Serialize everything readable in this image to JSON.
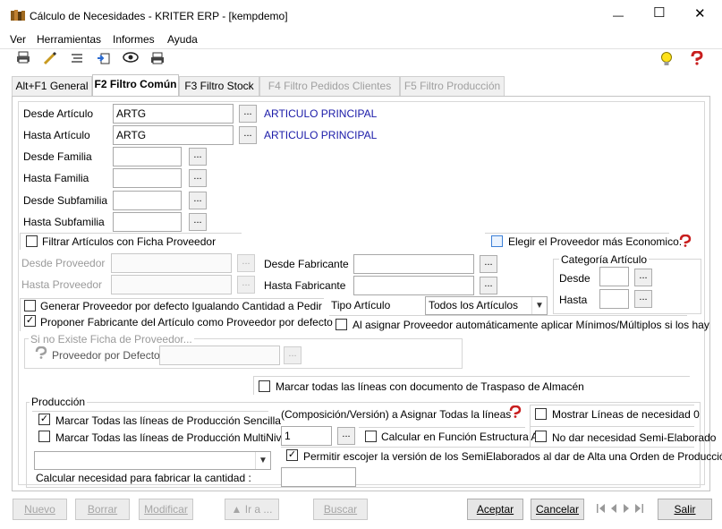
{
  "window": {
    "title": "Cálculo de Necesidades - KRITER ERP - [kempdemo]",
    "minimize": "—",
    "maximize": "☐",
    "close": "✕"
  },
  "menu": [
    "Ver",
    "Herramientas",
    "Informes",
    "Ayuda"
  ],
  "tabs": [
    {
      "label": "Alt+F1 General"
    },
    {
      "label": "F2 Filtro Común"
    },
    {
      "label": "F3 Filtro Stock"
    },
    {
      "label": "F4 Filtro Pedidos Clientes"
    },
    {
      "label": "F5 Filtro Producción"
    }
  ],
  "articles": {
    "desde_articulo": {
      "label": "Desde Artículo",
      "value": "ARTG",
      "desc": "ARTICULO PRINCIPAL"
    },
    "hasta_articulo": {
      "label": "Hasta Artículo",
      "value": "ARTG",
      "desc": "ARTICULO PRINCIPAL"
    },
    "desde_familia": {
      "label": "Desde Familia",
      "value": ""
    },
    "hasta_familia": {
      "label": "Hasta Familia",
      "value": ""
    },
    "desde_subfamilia": {
      "label": "Desde Subfamilia",
      "value": ""
    },
    "hasta_subfamilia": {
      "label": "Hasta Subfamilia",
      "value": ""
    }
  },
  "ellipsis": "...",
  "filtrar_ficha": {
    "label": "Filtrar Artículos con Ficha Proveedor",
    "checked": false
  },
  "elegir_proveedor": {
    "label": "Elegir el Proveedor más Economico.",
    "checked": false
  },
  "proveedor": {
    "desde_label": "Desde Proveedor",
    "hasta_label": "Hasta Proveedor"
  },
  "fabricante": {
    "desde_label": "Desde Fabricante",
    "hasta_label": "Hasta Fabricante"
  },
  "categoria": {
    "title": "Categoría Artículo",
    "desde_label": "Desde",
    "hasta_label": "Hasta"
  },
  "generar_proveedor": {
    "label": "Generar Proveedor por defecto Igualando Cantidad a Pedir",
    "checked": false
  },
  "proponer_fabricante": {
    "label": "Proponer Fabricante del Artículo como Proveedor por defecto",
    "checked": true
  },
  "tipo_articulo": {
    "label": "Tipo Artículo",
    "value": "Todos los Artículos"
  },
  "al_asignar": {
    "label": "Al asignar Proveedor automáticamente aplicar Mínimos/Múltiplos si los hay",
    "checked": false
  },
  "si_no_existe": {
    "title": "Si no Existe Ficha de Proveedor...",
    "proveedor_label": "Proveedor por Defecto"
  },
  "marcar_traspaso": {
    "label": "Marcar todas las líneas con documento de Traspaso de Almacén",
    "checked": false
  },
  "produccion": {
    "title": "Producción",
    "marcar_sencilla": {
      "label": "Marcar Todas las líneas de Producción Sencilla",
      "checked": true
    },
    "marcar_multinivel": {
      "label": "Marcar Todas las líneas de Producción MultiNivel",
      "checked": false
    },
    "composicion_label": "(Composición/Versión) a Asignar Todas la líneas",
    "composicion_value": "1",
    "calcular_estructura": {
      "label": "Calcular en Función Estructura Ar",
      "checked": false
    },
    "mostrar_lineas": {
      "label": "Mostrar Líneas de necesidad 0",
      "checked": false
    },
    "no_dar_necesidad": {
      "label": "No dar necesidad Semi-Elaborado",
      "checked": false
    },
    "permitir_version": {
      "label": "Permitir escojer la versión de los SemiElaborados al dar de Alta una Orden de Producción.",
      "checked": true
    },
    "calcular_cantidad_label": "Calcular necesidad para fabricar la cantidad :",
    "combo_value": ""
  },
  "buttons": {
    "nuevo": "Nuevo",
    "borrar": "Borrar",
    "modificar": "Modificar",
    "ira": "▲ Ir a ...",
    "buscar": "Buscar",
    "aceptar": "Aceptar",
    "cancelar": "Cancelar",
    "salir": "Salir"
  },
  "nav_icons": [
    "first-icon",
    "prev-icon",
    "next-icon",
    "last-icon"
  ],
  "colors": {
    "link_blue": "#1a1aa8",
    "help_red": "#c81e1e"
  }
}
